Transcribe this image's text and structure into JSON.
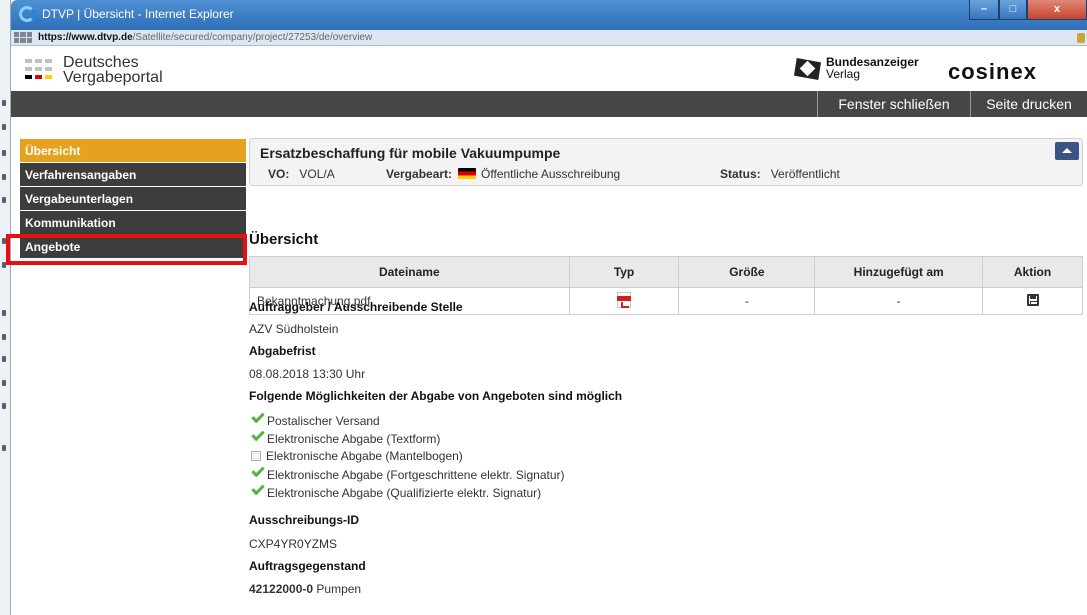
{
  "window": {
    "title": "DTVP | Übersicht - Internet Explorer",
    "minimize": "–",
    "maximize": "□",
    "close": "x"
  },
  "urlbar": {
    "url_bold": "https://www.dtvp.de",
    "url_rest": "/Satellite/secured/company/project/27253/de/overview"
  },
  "header": {
    "logo_line1": "Deutsches",
    "logo_line2": "Vergabeportal",
    "publisher_line1": "Bundesanzeiger",
    "publisher_line2": "Verlag",
    "partner": "cosinex"
  },
  "nav": {
    "close_window": "Fenster schließen",
    "print_page": "Seite drucken"
  },
  "sidebar": {
    "items": [
      {
        "label": "Übersicht",
        "active": true
      },
      {
        "label": "Verfahrensangaben"
      },
      {
        "label": "Vergabeunterlagen"
      },
      {
        "label": "Kommunikation"
      },
      {
        "label": "Angebote"
      }
    ]
  },
  "highlight_color": "#e80f12",
  "accent_color": "#e6a21f",
  "project": {
    "title": "Ersatzbeschaffung für mobile Vakuumpumpe",
    "vo_label": "VO:",
    "vo_value": "VOL/A",
    "type_label": "Vergabeart:",
    "type_value": "Öffentliche Ausschreibung",
    "status_label": "Status:",
    "status_value": "Veröffentlicht"
  },
  "overview": {
    "title": "Übersicht",
    "columns": [
      "Dateiname",
      "Typ",
      "Größe",
      "Hinzugefügt am",
      "Aktion"
    ],
    "rows": [
      {
        "name": "Bekanntmachung.pdf",
        "type_icon": "pdf-icon",
        "size": "-",
        "added": "-",
        "action_icon": "save-icon"
      }
    ]
  },
  "details": {
    "client_label": "Auftraggeber / Ausschreibende Stelle",
    "client_value": "AZV Südholstein",
    "deadline_label": "Abgabefrist",
    "deadline_value": "08.08.2018 13:30 Uhr",
    "options_label": "Folgende Möglichkeiten der Abgabe von Angeboten sind möglich",
    "options": [
      {
        "label": "Postalischer Versand",
        "enabled": true
      },
      {
        "label": "Elektronische Abgabe (Textform)",
        "enabled": true
      },
      {
        "label": "Elektronische Abgabe (Mantelbogen)",
        "enabled": false
      },
      {
        "label": "Elektronische Abgabe (Fortgeschrittene elektr. Signatur)",
        "enabled": true
      },
      {
        "label": "Elektronische Abgabe (Qualifizierte elektr. Signatur)",
        "enabled": true
      }
    ],
    "id_label": "Ausschreibungs-ID",
    "id_value": "CXP4YR0YZMS",
    "subject_label": "Auftragsgegenstand",
    "subject_code": "42122000-0",
    "subject_text": "Pumpen"
  }
}
